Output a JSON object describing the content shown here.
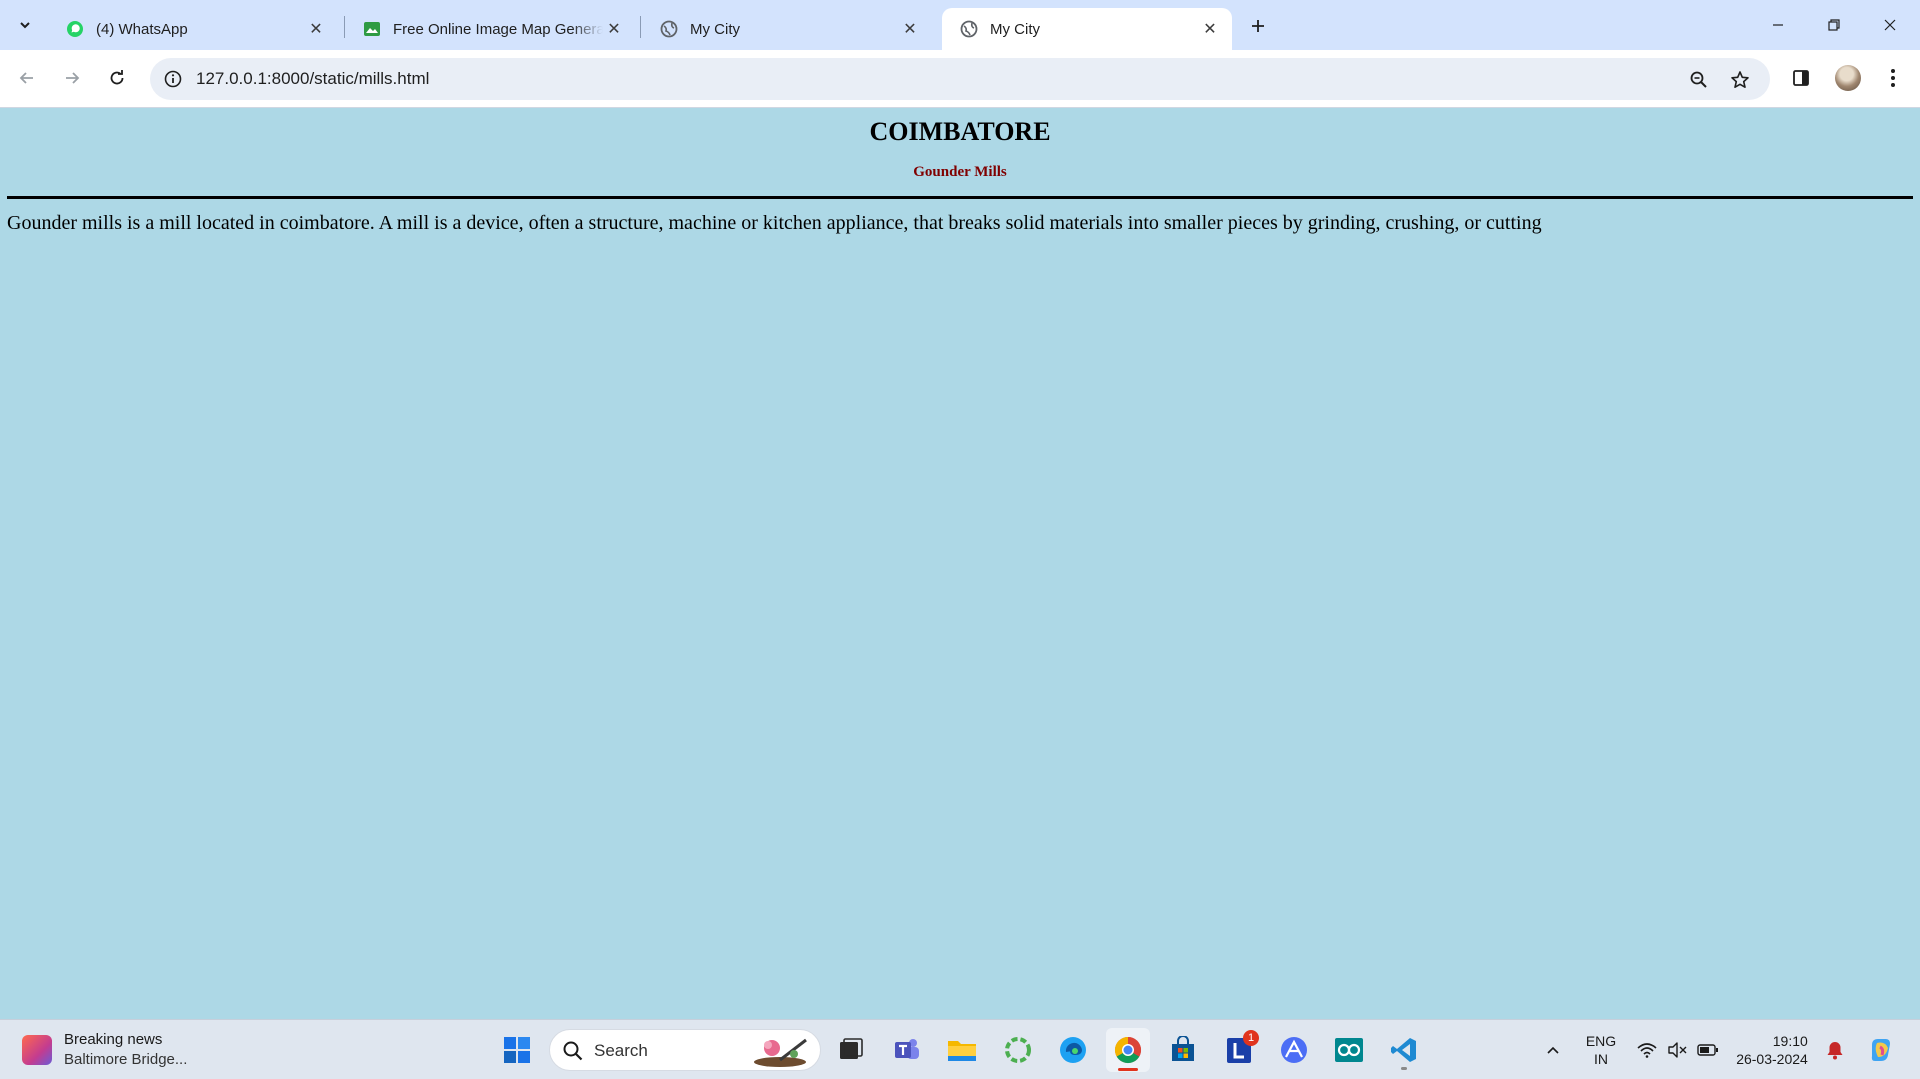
{
  "browser": {
    "tabs": [
      {
        "title": "(4) WhatsApp",
        "icon": "whatsapp-icon",
        "active": false
      },
      {
        "title": "Free Online Image Map Generator",
        "icon": "image-icon",
        "active": false
      },
      {
        "title": "My City",
        "icon": "globe-icon",
        "active": false
      },
      {
        "title": "My City",
        "icon": "globe-icon",
        "active": true
      }
    ],
    "url": "127.0.0.1:8000/static/mills.html"
  },
  "page": {
    "heading": "COIMBATORE",
    "subheading": "Gounder Mills",
    "paragraph": "Gounder mills is a mill located in coimbatore. A mill is a device, often a structure, machine or kitchen appliance, that breaks solid materials into smaller pieces by grinding, crushing, or cutting",
    "background_color": "#add8e6",
    "subheading_color": "#800000"
  },
  "taskbar": {
    "news_title": "Breaking news",
    "news_subtitle": "Baltimore Bridge...",
    "search_label": "Search",
    "language_line1": "ENG",
    "language_line2": "IN",
    "time": "19:10",
    "date": "26-03-2024",
    "lens_badge": "1"
  }
}
